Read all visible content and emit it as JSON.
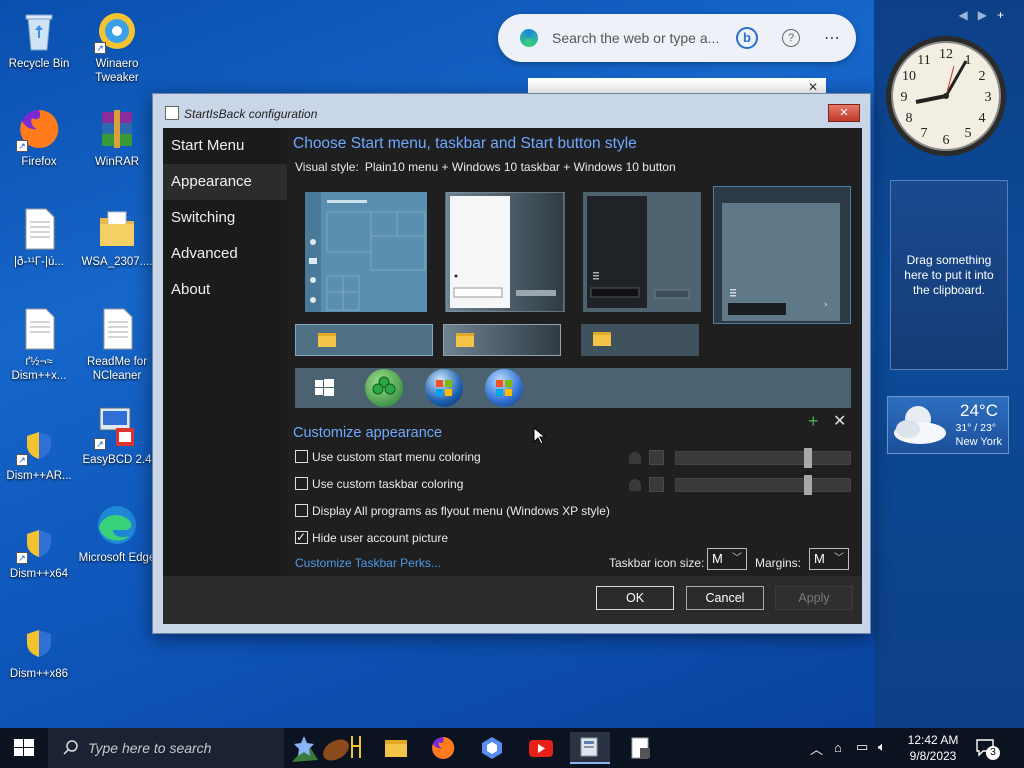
{
  "desktop": {
    "icons": [
      {
        "label": "Recycle Bin"
      },
      {
        "label": "Winaero Tweaker"
      },
      {
        "label": "Firefox"
      },
      {
        "label": "WinRAR"
      },
      {
        "label": "|ð-¹¹Г-|ú..."
      },
      {
        "label": "WSA_2307...."
      },
      {
        "label": "ґ½¬≈ Dism++x..."
      },
      {
        "label": "ReadMe for NCleaner"
      },
      {
        "label": "Dism++AR..."
      },
      {
        "label": "EasyBCD 2.4"
      },
      {
        "label": "Dism++x64"
      },
      {
        "label": "Microsoft Edge"
      },
      {
        "label": "Dism++x86"
      }
    ]
  },
  "search_bubble": {
    "placeholder": "Search the web or type a..."
  },
  "gadgets": {
    "clipboard": "Drag something here to put it into the clipboard.",
    "weather": {
      "temp": "24°C",
      "range": "31° / 23°",
      "city": "New York"
    }
  },
  "window": {
    "title": "StartIsBack configuration",
    "close": "✕",
    "nav": [
      "Start Menu",
      "Appearance",
      "Switching",
      "Advanced",
      "About"
    ],
    "selected_nav": "Appearance",
    "heading": "Choose Start menu, taskbar and Start button style",
    "visual_style_label": "Visual style:",
    "visual_style_value": "Plain10 menu + Windows 10 taskbar + Windows 10 button",
    "customize_heading": "Customize appearance",
    "options": [
      {
        "label": "Use custom start menu coloring",
        "checked": false
      },
      {
        "label": "Use custom taskbar coloring",
        "checked": false
      },
      {
        "label": "Display All programs as flyout menu (Windows XP style)",
        "checked": false
      },
      {
        "label": "Hide user account picture",
        "checked": true
      }
    ],
    "link": "Customize Taskbar Perks...",
    "icon_size_label": "Taskbar icon size:",
    "icon_size_value": "M",
    "margins_label": "Margins:",
    "margins_value": "M",
    "buttons": {
      "ok": "OK",
      "cancel": "Cancel",
      "apply": "Apply"
    }
  },
  "taskbar": {
    "search_placeholder": "Type here to search",
    "time": "12:42 AM",
    "date": "9/8/2023",
    "notifications": "3"
  }
}
